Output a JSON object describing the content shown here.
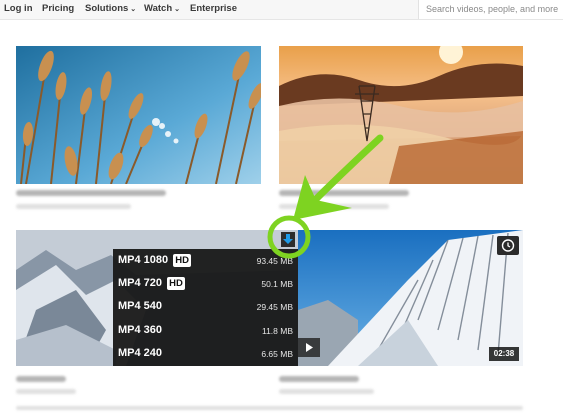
{
  "nav": {
    "login": "Log in",
    "pricing": "Pricing",
    "solutions": "Solutions",
    "watch": "Watch",
    "enterprise": "Enterprise",
    "caret": "⌄",
    "search_placeholder": "Search videos, people, and more"
  },
  "thumbnails": [
    {
      "name": "wheat-field",
      "subject": "wheat against blue sky"
    },
    {
      "name": "foggy-sunset",
      "subject": "power pylon in misty sunset"
    },
    {
      "name": "snowy-mountains-left",
      "subject": "snowy mountain valley"
    },
    {
      "name": "snowy-mountain-right",
      "subject": "snow covered mountain ridge",
      "duration": "02:38"
    }
  ],
  "download_menu": {
    "items": [
      {
        "format": "MP4 1080",
        "hd": "HD",
        "size": "93.45 MB"
      },
      {
        "format": "MP4 720",
        "hd": "HD",
        "size": "50.1 MB"
      },
      {
        "format": "MP4 540",
        "hd": "",
        "size": "29.45 MB"
      },
      {
        "format": "MP4 360",
        "hd": "",
        "size": "11.8 MB"
      },
      {
        "format": "MP4 240",
        "hd": "",
        "size": "6.65 MB"
      }
    ]
  },
  "icons": {
    "download": "download-arrow-icon",
    "clock": "clock-icon",
    "play": "play-icon"
  },
  "colors": {
    "annotation": "#7ed321",
    "download_icon": "#1e9be8",
    "menu_bg": "#181818"
  }
}
